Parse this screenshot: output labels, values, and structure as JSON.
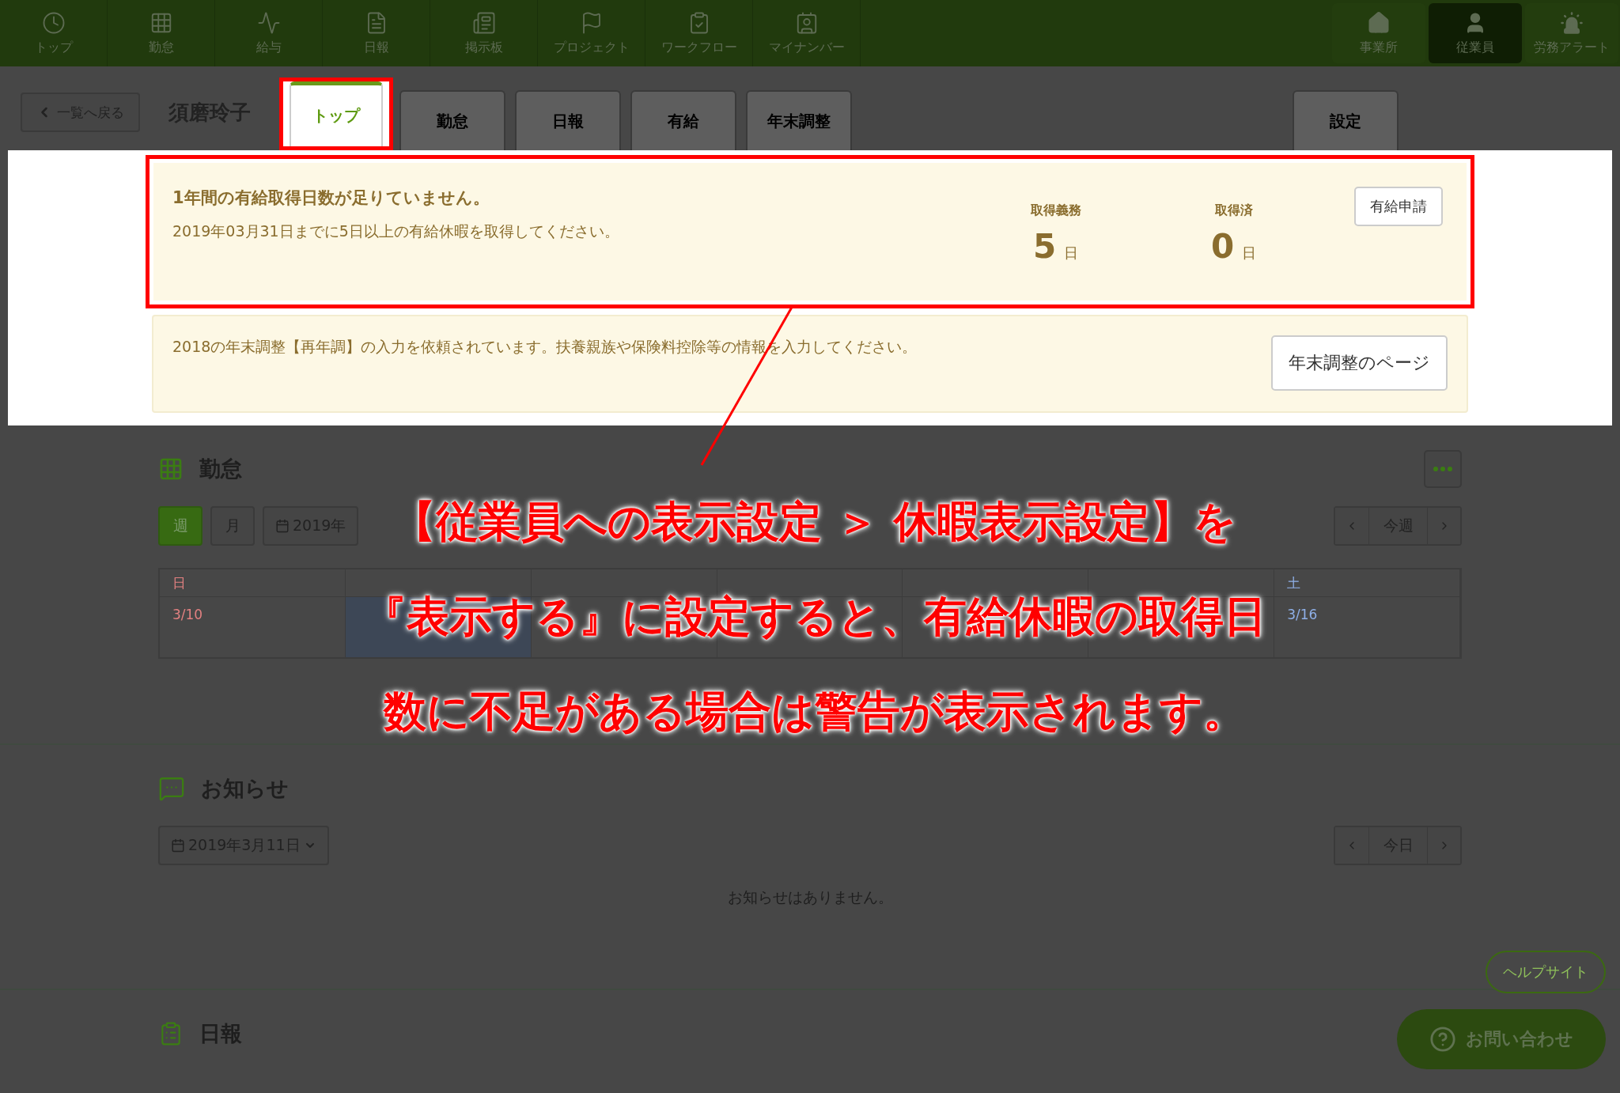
{
  "nav": {
    "items": [
      {
        "label": "トップ",
        "selected": false
      },
      {
        "label": "勤怠",
        "selected": false
      },
      {
        "label": "給与",
        "selected": false
      },
      {
        "label": "日報",
        "selected": false
      },
      {
        "label": "掲示板",
        "selected": false
      },
      {
        "label": "プロジェクト",
        "selected": false
      },
      {
        "label": "ワークフロー",
        "selected": false
      },
      {
        "label": "マイナンバー",
        "selected": false
      }
    ],
    "right_items": [
      {
        "label": "事業所",
        "selected": false
      },
      {
        "label": "従業員",
        "selected": true
      },
      {
        "label": "労務アラート",
        "selected": false
      }
    ]
  },
  "header": {
    "back": "一覧へ戻る",
    "name": "須磨玲子",
    "tabs": [
      {
        "label": "トップ",
        "selected": true
      },
      {
        "label": "勤怠",
        "selected": false
      },
      {
        "label": "日報",
        "selected": false
      },
      {
        "label": "有給",
        "selected": false
      },
      {
        "label": "年末調整",
        "selected": false
      }
    ],
    "settings_tab": "設定"
  },
  "alert": {
    "title": "1年間の有給取得日数が足りていません。",
    "body": "2019年03月31日までに5日以上の有給休暇を取得してください。",
    "stats": [
      {
        "label": "取得義務",
        "value": "5",
        "unit": "日"
      },
      {
        "label": "取得済",
        "value": "0",
        "unit": "日"
      }
    ],
    "button": "有給申請"
  },
  "notice": {
    "text": "2018の年末調整【再年調】の入力を依頼されています。扶養親族や保険料控除等の情報を入力してください。",
    "button": "年末調整のページ"
  },
  "attendance": {
    "title": "勤怠",
    "modes": [
      {
        "label": "週",
        "selected": true
      },
      {
        "label": "月",
        "selected": false
      }
    ],
    "date": "2019年",
    "nav": "今週",
    "days": [
      {
        "header": "日",
        "date": "3/10",
        "today": false
      },
      {
        "today": true
      },
      {
        "today": false
      },
      {
        "today": false
      },
      {
        "today": false
      },
      {
        "today": false
      },
      {
        "header": "土",
        "date": "3/16",
        "today": false
      }
    ]
  },
  "news": {
    "title": "お知らせ",
    "date": "2019年3月11日",
    "nav": "今日",
    "empty": "お知らせはありません。"
  },
  "daily": {
    "title": "日報"
  },
  "help": "ヘルプサイト",
  "contact": "お問い合わせ",
  "annotation": [
    "【従業員への表示設定 ＞ 休暇表示設定】を",
    "『表示する』に設定すると、有給休暇の取得日",
    "数に不足がある場合は警告が表示されます。"
  ]
}
